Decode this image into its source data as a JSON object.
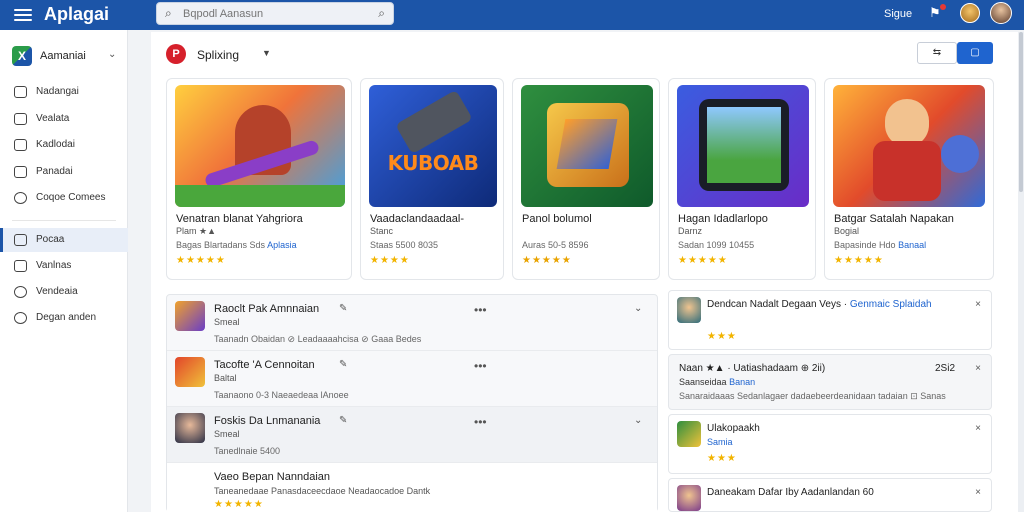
{
  "topbar": {
    "brand": "Aplagai",
    "search_placeholder": "Bqpodl Aanasun",
    "search_icon": "search-icon",
    "search_right_icon": "search-icon",
    "user_label": "Sigue",
    "colors": {
      "bar": "#1c55a8"
    }
  },
  "sidebar": {
    "workspace": {
      "logo_letter": "X",
      "name": "Aamaniai"
    },
    "items": [
      {
        "label": "Nadangai",
        "icon": "home-icon"
      },
      {
        "label": "Vealata",
        "icon": "folder-icon"
      },
      {
        "label": "Kadlodai",
        "icon": "document-icon"
      },
      {
        "label": "Panadai",
        "icon": "grid-icon"
      },
      {
        "label": "Coqoe Comees",
        "icon": "gamepad-icon"
      },
      {
        "label": "Pocaa",
        "icon": "bookmark-icon"
      },
      {
        "label": "Vanlnas",
        "icon": "calendar-icon"
      },
      {
        "label": "Vendeaia",
        "icon": "chat-icon"
      },
      {
        "label": "Degan anden",
        "icon": "settings-icon"
      }
    ]
  },
  "header": {
    "title": "Splixing",
    "logo_letter": "P",
    "view_a": "⇆",
    "view_b": "▢"
  },
  "cards": [
    {
      "title": "Venatran blanat Yahgriora",
      "sub1": "Plam ★▲",
      "sub2": "Bagas Blartadans Sds",
      "link": "Aplasia",
      "stars": "★★★★★"
    },
    {
      "title": "Vaadaclandaadaal-",
      "sub1": "Stanc",
      "sub2": "Staas 5500 8035",
      "link": "",
      "stars": "★★★★",
      "image_text": "KUBOAB"
    },
    {
      "title": "Panol bolumol",
      "sub1": "",
      "sub2": "Auras 50-5 8596",
      "link": "",
      "stars": "★★★★★"
    },
    {
      "title": "Hagan Idadlarlopo",
      "sub1": "Darnz",
      "sub2": "Sadan 1099 10455",
      "link": "",
      "stars": "★★★★★"
    },
    {
      "title": "Batgar Satalah Napakan",
      "sub1": "Bogial",
      "sub2": "Bapasinde Hdo",
      "link": "Banaal",
      "stars": "★★★★★"
    }
  ],
  "list": [
    {
      "title": "Raoclt Pak Amnnaian",
      "sub": "Smeal",
      "meta": "Taanadn Obaidan   ⊘ Leadaaaahcisa   ⊘ Gaaa Bedes",
      "pin": "✎",
      "dots": "•••",
      "chev": "⌄",
      "stars": ""
    },
    {
      "title": "Tacofte 'A Cennoitan",
      "sub": "Baltal",
      "meta": "Taanaono 0-3                   Naeaedeaa                                       lAnoee",
      "pin": "✎",
      "dots": "•••",
      "chev": "",
      "stars": ""
    },
    {
      "title": "Foskis Da Lnmanania",
      "sub": "Smeal",
      "meta": "Tanedlnaie 5400",
      "pin": "✎",
      "dots": "•••",
      "chev": "⌄",
      "stars": ""
    },
    {
      "title": "Vaeo Bepan Nanndaian",
      "sub": "",
      "meta": "Taneanedaae Panasdaceecdaoe Neadaocadoe Dantk",
      "pin": "",
      "dots": "",
      "chev": "",
      "stars": "★★★★★"
    }
  ],
  "right": [
    {
      "title": "Dendcan Nadalt Degaan Veys",
      "link": "Genmaic Splaidah",
      "sub": "",
      "meta": "",
      "stars": "★★★",
      "close": "×"
    },
    {
      "title": "Naan ★▲ · Uatiashadaam ⊕ 2ii)",
      "link": "",
      "right": "2Si2",
      "sub": "Saanseidaa",
      "subsub": "Banan",
      "meta": "Sanaraidaaas Sedanlagaer dadaebeerdeanidaan tadaian   ⊡ Sanas",
      "stars": "",
      "close": "×"
    },
    {
      "title": "Ulakopaakh",
      "link": "",
      "sub": "Samia",
      "meta": "",
      "stars": "★★★",
      "close": "×"
    },
    {
      "title": "Daneakam Dafar Iby Aadanlandan  60",
      "link": "",
      "sub": "",
      "meta": "",
      "stars": "",
      "close": "×"
    }
  ]
}
